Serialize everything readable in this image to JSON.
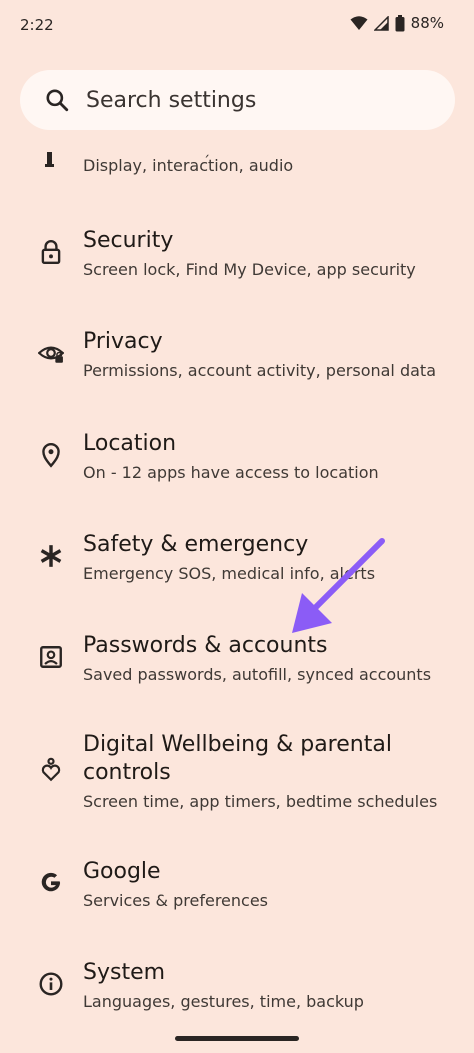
{
  "status_bar": {
    "time": "2:22",
    "battery": "88%"
  },
  "search": {
    "placeholder": "Search settings"
  },
  "partial_item": {
    "subtitle": "Display, interaction, audio"
  },
  "items": [
    {
      "title": "Security",
      "subtitle": "Screen lock, Find My Device, app security",
      "icon": "lock-icon"
    },
    {
      "title": "Privacy",
      "subtitle": "Permissions, account activity, personal data",
      "icon": "privacy-eye-icon"
    },
    {
      "title": "Location",
      "subtitle": "On - 12 apps have access to location",
      "icon": "location-pin-icon"
    },
    {
      "title": "Safety & emergency",
      "subtitle": "Emergency SOS, medical info, alerts",
      "icon": "asterisk-icon"
    },
    {
      "title": "Passwords & accounts",
      "subtitle": "Saved passwords, autofill, synced accounts",
      "icon": "account-box-icon"
    },
    {
      "title": "Digital Wellbeing & parental controls",
      "subtitle": "Screen time, app timers, bedtime schedules",
      "icon": "wellbeing-icon"
    },
    {
      "title": "Google",
      "subtitle": "Services & preferences",
      "icon": "google-g-icon"
    },
    {
      "title": "System",
      "subtitle": "Languages, gestures, time, backup",
      "icon": "info-icon"
    }
  ],
  "colors": {
    "background": "#fce6dc",
    "search_bg": "#fff7f3",
    "arrow": "#8b5cf6"
  }
}
